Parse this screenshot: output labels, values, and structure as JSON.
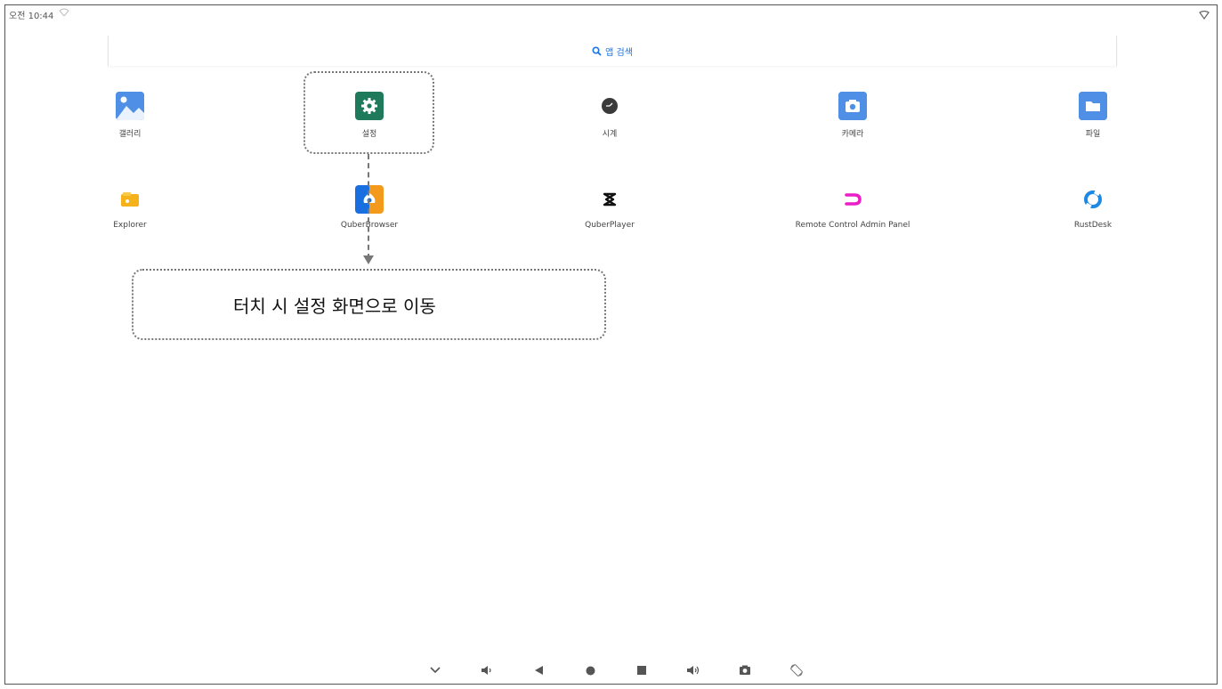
{
  "status_bar": {
    "time": "오전 10:44"
  },
  "search": {
    "label": "앱 검색"
  },
  "apps": [
    {
      "label": "갤러리"
    },
    {
      "label": "설정"
    },
    {
      "label": "시계"
    },
    {
      "label": "카메라"
    },
    {
      "label": "파일"
    },
    {
      "label": "Explorer"
    },
    {
      "label": "QuberBrowser"
    },
    {
      "label": "QuberPlayer"
    },
    {
      "label": "Remote Control Admin Panel"
    },
    {
      "label": "RustDesk"
    }
  ],
  "annotation": {
    "text": "터치 시 설정 화면으로 이동"
  },
  "navbar": {
    "buttons": [
      "chevron-down-icon",
      "volume-down-icon",
      "back-icon",
      "home-icon",
      "recents-icon",
      "volume-up-icon",
      "screenshot-icon",
      "rotate-icon"
    ]
  },
  "colors": {
    "accent": "#1a73e8",
    "settings_green": "#1f7a5c",
    "annotation_border": "#777777"
  }
}
